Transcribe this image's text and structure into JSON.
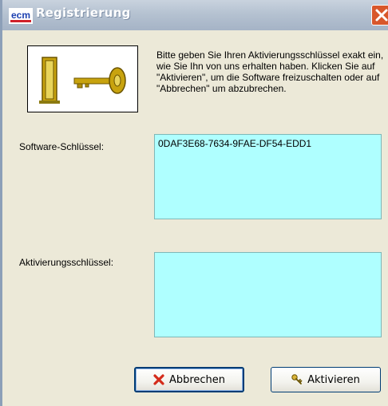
{
  "window": {
    "title": "Registrierung",
    "app_logo_text": "ecm"
  },
  "instructions": "Bitte geben Sie Ihren Aktivierungsschlüssel exakt ein, wie Sie Ihn von uns erhalten haben. Klicken Sie auf \"Aktivieren\", um die Software freizuschalten oder auf \"Abbrechen\" um abzubrechen.",
  "software_key": {
    "label": "Software-Schlüssel:",
    "value": "0DAF3E68-7634-9FAE-DF54-EDD1"
  },
  "activation_key": {
    "label": "Aktivierungsschlüssel:",
    "value": ""
  },
  "buttons": {
    "cancel_label": "Abbrechen",
    "activate_label": "Aktivieren"
  },
  "colors": {
    "dialog_bg": "#ECE9D8",
    "field_bg": "#AFFFFF",
    "close_red": "#D8572B"
  },
  "icons": {
    "app": "ecm-logo-icon",
    "close": "close-icon",
    "illustration": "door-key-icon",
    "cancel": "red-x-icon",
    "activate": "key-icon"
  }
}
